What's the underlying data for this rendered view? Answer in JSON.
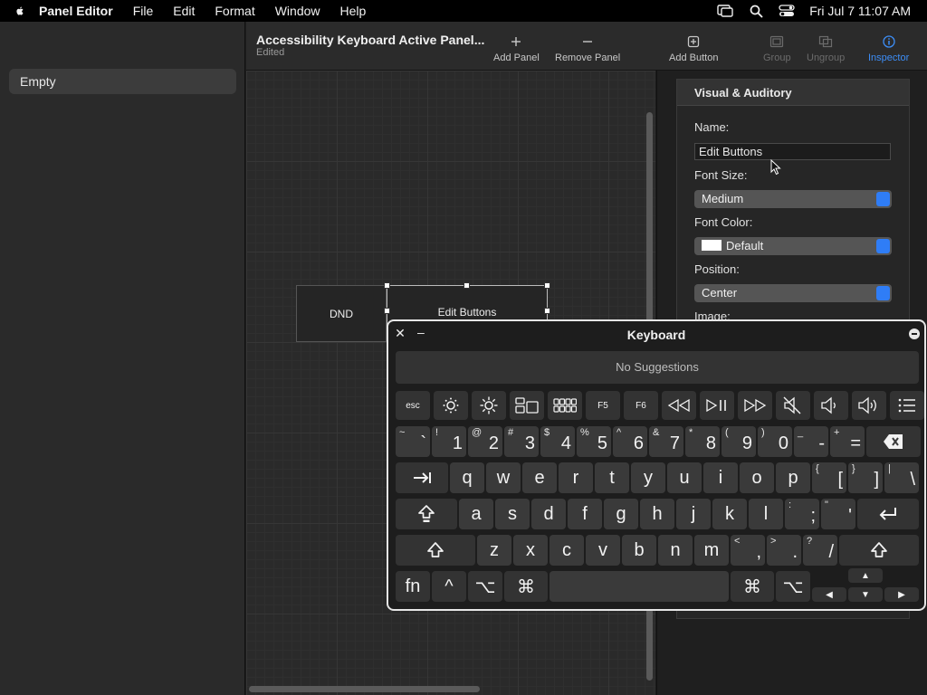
{
  "menubar": {
    "app_name": "Panel Editor",
    "items": [
      "File",
      "Edit",
      "Format",
      "Window",
      "Help"
    ],
    "clock": "Fri Jul 7  11:07 AM"
  },
  "sidebar": {
    "items": [
      "Empty"
    ]
  },
  "toolbar": {
    "title": "Accessibility Keyboard Active Panel...",
    "subtitle": "Edited",
    "add_panel": "Add Panel",
    "remove_panel": "Remove Panel",
    "add_button": "Add Button",
    "group": "Group",
    "ungroup": "Ungroup",
    "inspector": "Inspector"
  },
  "canvas": {
    "buttons": [
      "DND",
      "Edit Buttons"
    ]
  },
  "inspector": {
    "section_title": "Visual & Auditory",
    "name_label": "Name:",
    "name_value": "Edit Buttons",
    "font_size_label": "Font Size:",
    "font_size_value": "Medium",
    "font_color_label": "Font Color:",
    "font_color_value": "Default",
    "position_label": "Position:",
    "position_value": "Center",
    "image_label": "Image:"
  },
  "keyboard": {
    "title": "Keyboard",
    "suggestions": "No Suggestions",
    "function_row": [
      {
        "label": "esc",
        "icon": null
      },
      {
        "label": null,
        "icon": "brightness-down-icon"
      },
      {
        "label": null,
        "icon": "brightness-up-icon"
      },
      {
        "label": null,
        "icon": "mission-control-icon"
      },
      {
        "label": null,
        "icon": "launchpad-icon"
      },
      {
        "label": "F5",
        "icon": null
      },
      {
        "label": "F6",
        "icon": null
      },
      {
        "label": null,
        "icon": "rewind-icon"
      },
      {
        "label": null,
        "icon": "play-pause-icon"
      },
      {
        "label": null,
        "icon": "fast-forward-icon"
      },
      {
        "label": null,
        "icon": "mute-icon"
      },
      {
        "label": null,
        "icon": "volume-down-icon"
      },
      {
        "label": null,
        "icon": "volume-up-icon"
      },
      {
        "label": null,
        "icon": "list-icon"
      }
    ],
    "number_row": [
      {
        "shift": "~",
        "main": "`"
      },
      {
        "shift": "!",
        "main": "1"
      },
      {
        "shift": "@",
        "main": "2"
      },
      {
        "shift": "#",
        "main": "3"
      },
      {
        "shift": "$",
        "main": "4"
      },
      {
        "shift": "%",
        "main": "5"
      },
      {
        "shift": "^",
        "main": "6"
      },
      {
        "shift": "&",
        "main": "7"
      },
      {
        "shift": "*",
        "main": "8"
      },
      {
        "shift": "(",
        "main": "9"
      },
      {
        "shift": ")",
        "main": "0"
      },
      {
        "shift": "_",
        "main": "-"
      },
      {
        "shift": "+",
        "main": "="
      }
    ],
    "row_q": [
      "q",
      "w",
      "e",
      "r",
      "t",
      "y",
      "u",
      "i",
      "o",
      "p"
    ],
    "row_q_sym": [
      {
        "shift": "{",
        "main": "["
      },
      {
        "shift": "}",
        "main": "]"
      },
      {
        "shift": "|",
        "main": "\\"
      }
    ],
    "row_a": [
      "a",
      "s",
      "d",
      "f",
      "g",
      "h",
      "j",
      "k",
      "l"
    ],
    "row_a_sym": [
      {
        "shift": ":",
        "main": ";"
      },
      {
        "shift": "\"",
        "main": "'"
      }
    ],
    "row_z": [
      "z",
      "x",
      "c",
      "v",
      "b",
      "n",
      "m"
    ],
    "row_z_sym": [
      {
        "shift": "<",
        "main": ","
      },
      {
        "shift": ">",
        "main": "."
      },
      {
        "shift": "?",
        "main": "/"
      }
    ],
    "bottom": {
      "fn": "fn",
      "control": "^",
      "option": "⌥",
      "command": "⌘",
      "arrow_up": "▲",
      "arrow_left": "◀",
      "arrow_down": "▼",
      "arrow_right": "▶"
    }
  }
}
